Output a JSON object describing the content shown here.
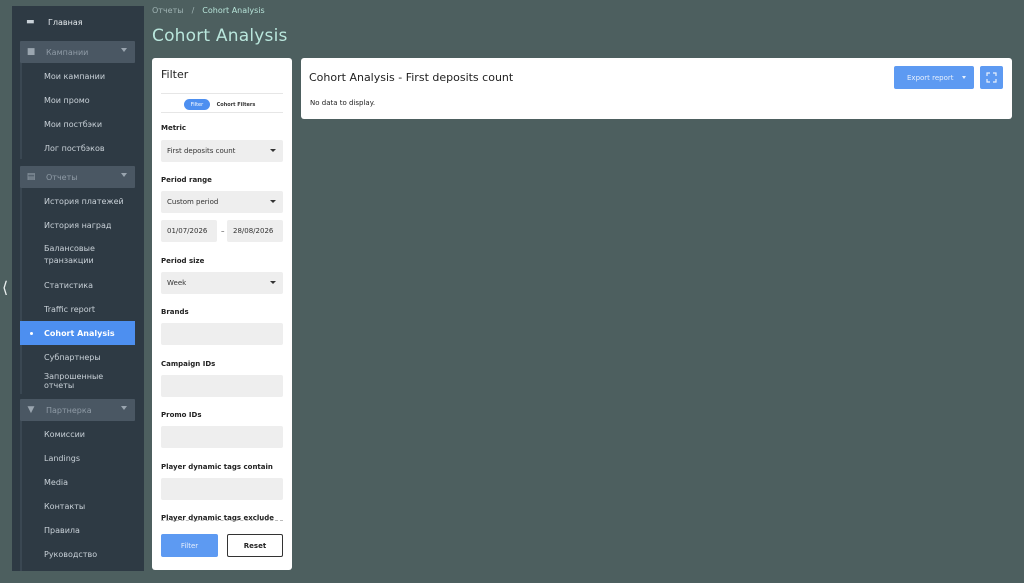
{
  "sidebar": {
    "home_label": "Главная",
    "groups": [
      {
        "label": "Кампании",
        "items": [
          "Мои кампании",
          "Мои промо",
          "Мои постбэки",
          "Лог постбэков"
        ]
      },
      {
        "label": "Отчеты",
        "items": [
          "История платежей",
          "История наград",
          "Балансовые транзакции",
          "Статистика",
          "Traffic report",
          "Cohort Analysis",
          "Субпартнеры",
          "Запрошенные отчеты"
        ],
        "active": "Cohort Analysis"
      },
      {
        "label": "Партнерка",
        "items": [
          "Комиссии",
          "Landings",
          "Media",
          "Контакты",
          "Правила",
          "Руководство"
        ]
      }
    ]
  },
  "breadcrumb": {
    "parent": "Отчеты",
    "separator": "/",
    "current": "Cohort Analysis"
  },
  "page_title": "Cohort Analysis",
  "filter_panel": {
    "title": "Filter",
    "tabs": [
      "Filter",
      "Cohort Filters"
    ],
    "active_tab": "Filter",
    "metric": {
      "label": "Metric",
      "value": "First deposits count"
    },
    "period_range": {
      "label": "Period range",
      "value": "Custom period",
      "date_from": "01/07/2026",
      "dash": "–",
      "date_to": "28/08/2026"
    },
    "period_size": {
      "label": "Period size",
      "value": "Week"
    },
    "brands": {
      "label": "Brands"
    },
    "campaign_ids": {
      "label": "Campaign IDs"
    },
    "promo_ids": {
      "label": "Promo IDs"
    },
    "tags_contain": {
      "label": "Player dynamic tags contain"
    },
    "tags_exclude": {
      "label": "Player dynamic tags exclude"
    },
    "filter_button": "Filter",
    "reset_button": "Reset"
  },
  "result_panel": {
    "title": "Cohort Analysis - First deposits count",
    "empty_message": "No data to display.",
    "export_label": "Export report"
  },
  "colors": {
    "background": "#4d5f5f",
    "sidebar": "#2e3a44",
    "accent": "#4d8ff0",
    "title_accent": "#b9e6dc"
  }
}
